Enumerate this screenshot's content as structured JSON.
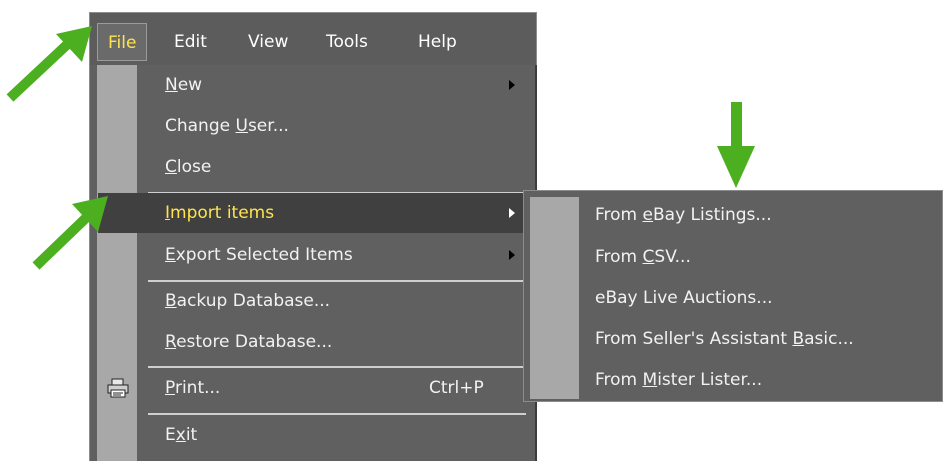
{
  "menubar": {
    "items": [
      {
        "label": "File",
        "active": true
      },
      {
        "label": "Edit"
      },
      {
        "label": "View"
      },
      {
        "label": "Tools"
      },
      {
        "label": "Help"
      }
    ]
  },
  "file_menu": {
    "items": [
      {
        "label": "New",
        "mnemonic": "N",
        "submenu": true
      },
      {
        "label": "Change User...",
        "mnemonic": "U"
      },
      {
        "label": "Close",
        "mnemonic": "C"
      },
      {
        "label": "Import items",
        "mnemonic": "I",
        "submenu": true,
        "highlighted": true
      },
      {
        "label": "Export Selected Items",
        "mnemonic": "E",
        "submenu": true
      },
      {
        "label": "Backup Database...",
        "mnemonic": "B"
      },
      {
        "label": "Restore Database...",
        "mnemonic": "R"
      },
      {
        "label": "Print...",
        "mnemonic": "P",
        "shortcut": "Ctrl+P",
        "icon": "printer-icon"
      },
      {
        "label": "Exit",
        "mnemonic": "x"
      }
    ]
  },
  "import_submenu": {
    "items": [
      {
        "label": "From eBay Listings...",
        "mnemonic": "e"
      },
      {
        "label": "From CSV...",
        "mnemonic": "C"
      },
      {
        "label": "eBay Live Auctions..."
      },
      {
        "label": "From Seller's Assistant Basic...",
        "mnemonic": "B"
      },
      {
        "label": "From Mister Lister...",
        "mnemonic": "M"
      }
    ]
  },
  "colors": {
    "menu_bg": "#606060",
    "gutter": "#a8a8a8",
    "highlight_bg": "#404040",
    "highlight_text": "#ffe44d",
    "annotation_arrow": "#4caf1f"
  },
  "annotations": [
    {
      "icon": "green-arrow-icon",
      "points_to": "File"
    },
    {
      "icon": "green-arrow-icon",
      "points_to": "Import items"
    },
    {
      "icon": "green-arrow-icon",
      "points_to": "From eBay Listings..."
    }
  ]
}
